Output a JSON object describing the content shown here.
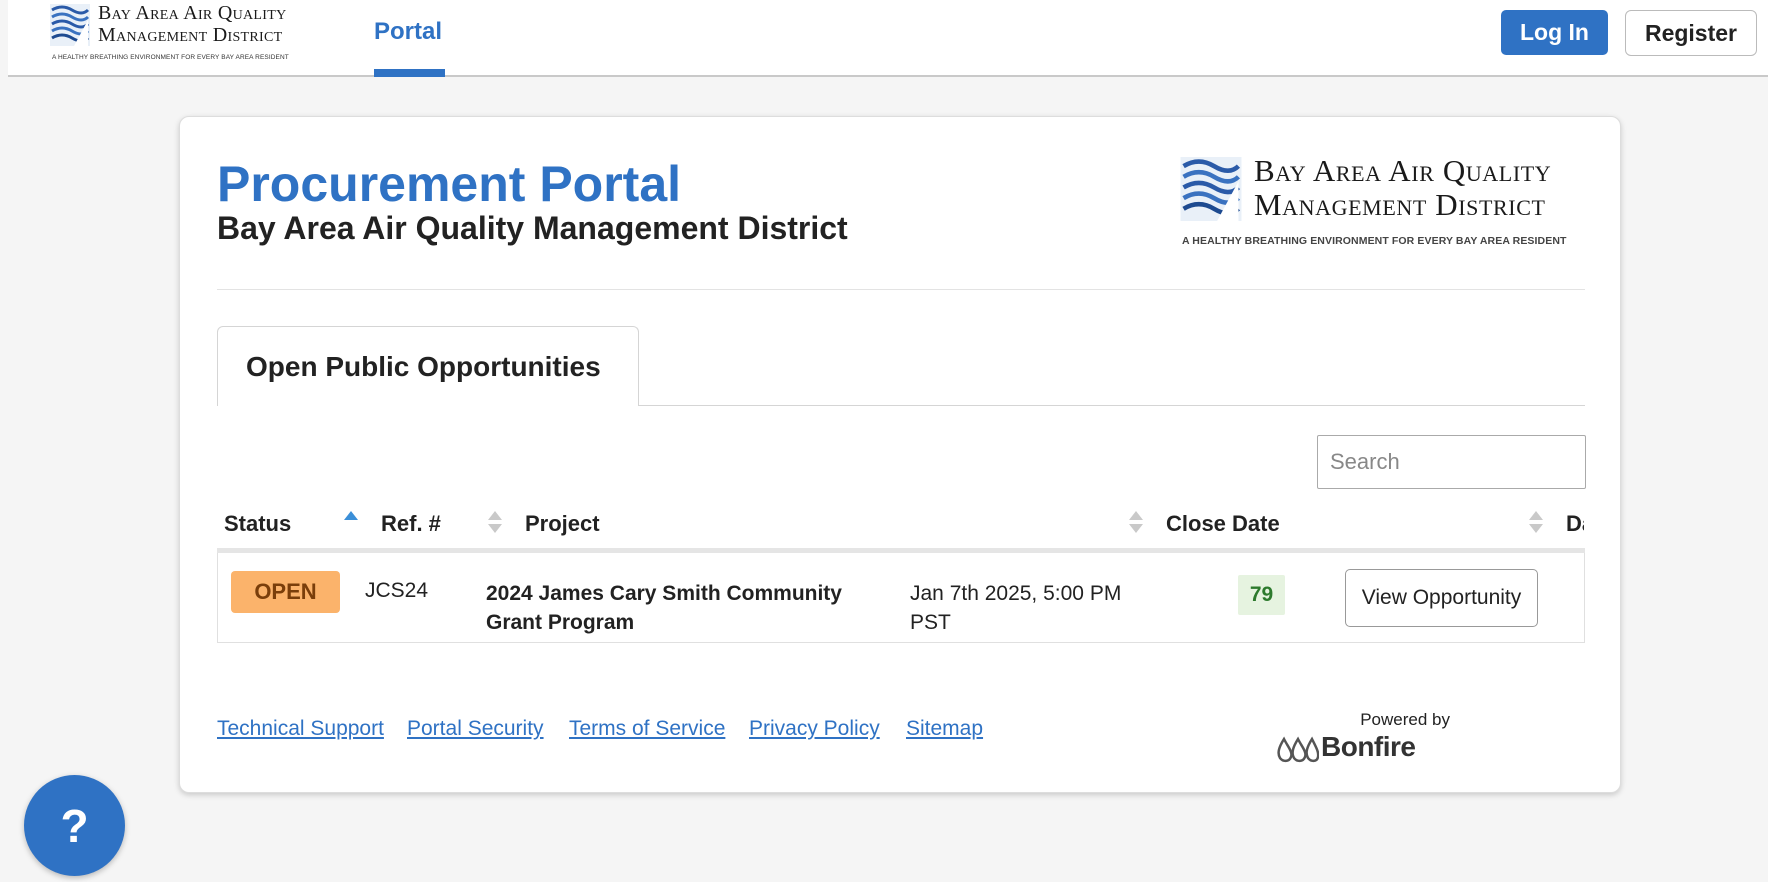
{
  "org": {
    "name_line1": "Bay Area Air Quality",
    "name_line2": "Management District",
    "tagline": "A HEALTHY BREATHING ENVIRONMENT FOR EVERY BAY AREA RESIDENT"
  },
  "navbar": {
    "tab_label": "Portal",
    "login_label": "Log In",
    "register_label": "Register"
  },
  "header": {
    "title": "Procurement Portal",
    "subtitle": "Bay Area Air Quality Management District"
  },
  "tabs": [
    {
      "label": "Open Public Opportunities",
      "active": true
    }
  ],
  "search": {
    "placeholder": "Search",
    "value": ""
  },
  "table": {
    "columns": [
      "Status",
      "Ref. #",
      "Project",
      "Close Date",
      "Da"
    ],
    "sort": {
      "column": "Status",
      "direction": "ascending"
    },
    "rows": [
      {
        "status": "OPEN",
        "ref": "JCS24",
        "project": "2024 James Cary Smith Community Grant Program",
        "close_date": "Jan 7th 2025, 5:00 PM PST",
        "days_left": "79",
        "action_label": "View Opportunity"
      }
    ]
  },
  "footer": {
    "links": [
      "Technical Support",
      "Portal Security",
      "Terms of Service",
      "Privacy Policy",
      "Sitemap"
    ],
    "powered_by": "Powered by",
    "vendor": "Bonfire"
  },
  "help": {
    "label": "?"
  },
  "colors": {
    "brand_blue": "#2f72c4",
    "open_badge": "#fbb36b",
    "days_left_bg": "#e6f3e0",
    "days_left_text": "#2d7a2d"
  },
  "icons": [
    "baaqmd-logo-icon",
    "sort-ascending-icon",
    "sort-icon",
    "bonfire-logo-icon",
    "help-icon"
  ]
}
